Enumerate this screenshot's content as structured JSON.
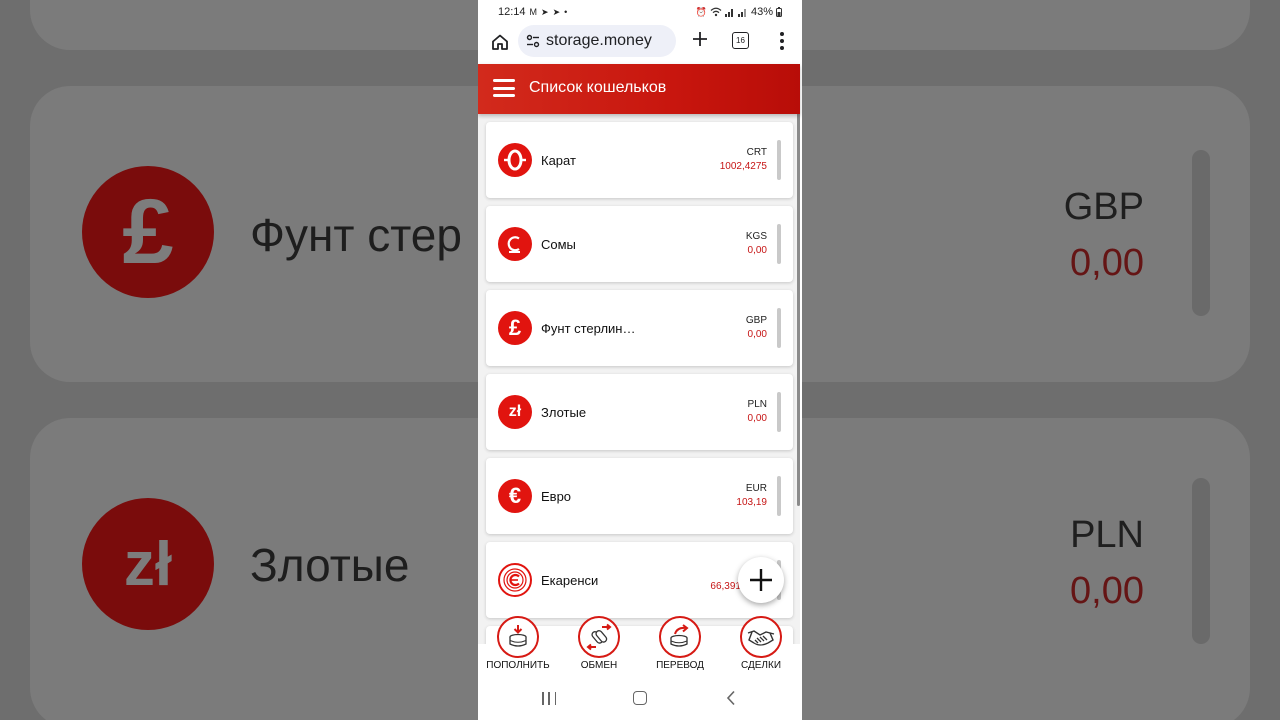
{
  "background": {
    "cards": [
      {
        "icon_glyph": "£",
        "name": "Фунт стер",
        "code": "GBP",
        "value": "0,00"
      },
      {
        "icon_glyph": "zł",
        "name": "Злотые",
        "code": "PLN",
        "value": "0,00"
      }
    ]
  },
  "statusbar": {
    "time": "12:14",
    "battery": "43%"
  },
  "browser": {
    "url": "storage.money",
    "tabs_count": "16"
  },
  "app": {
    "title": "Список кошельков"
  },
  "wallets": [
    {
      "name": "Карат",
      "code": "CRT",
      "value": "1002,4275",
      "icon": "carat-coin-icon",
      "glyph": "0"
    },
    {
      "name": "Сомы",
      "code": "KGS",
      "value": "0,00",
      "icon": "som-coin-icon",
      "glyph": "С"
    },
    {
      "name": "Фунт стерлин…",
      "code": "GBP",
      "value": "0,00",
      "icon": "pound-coin-icon",
      "glyph": "£"
    },
    {
      "name": "Злотые",
      "code": "PLN",
      "value": "0,00",
      "icon": "zloty-coin-icon",
      "glyph": "zł"
    },
    {
      "name": "Евро",
      "code": "EUR",
      "value": "103,19",
      "icon": "euro-coin-icon",
      "glyph": "€"
    },
    {
      "name": "Екаренси",
      "code": "",
      "value": "66,391",
      "icon": "ecurrency-coin-icon",
      "glyph": "e"
    }
  ],
  "bottom_nav": [
    {
      "label": "ПОПОЛНИТЬ",
      "icon": "deposit-icon"
    },
    {
      "label": "ОБМЕН",
      "icon": "exchange-icon"
    },
    {
      "label": "ПЕРЕВОД",
      "icon": "transfer-icon"
    },
    {
      "label": "СДЕЛКИ",
      "icon": "deals-handshake-icon"
    }
  ],
  "colors": {
    "brand_red": "#d61a14",
    "value_red": "#c61515"
  }
}
